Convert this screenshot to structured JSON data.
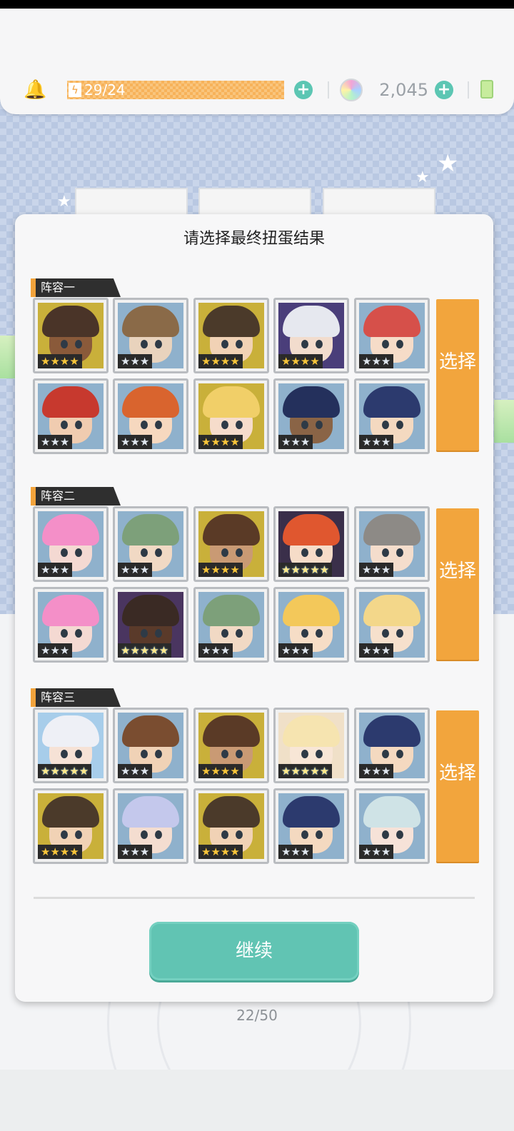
{
  "topbar": {
    "stamina": "29/24",
    "gems": "2,045"
  },
  "modal": {
    "title": "请选择最终扭蛋结果",
    "continue_label": "继续",
    "select_label": "选择"
  },
  "groups": [
    {
      "name": "阵容一",
      "characters": [
        {
          "stars": 4,
          "rank": "gold",
          "hair": "#4a3428",
          "skin": "#8a5a3a",
          "bg": "#c9b03a"
        },
        {
          "stars": 3,
          "rank": "silver",
          "hair": "#8a6a48",
          "skin": "#e9d3bd",
          "bg": "#8fb1cc"
        },
        {
          "stars": 4,
          "rank": "gold",
          "hair": "#4b3a2a",
          "skin": "#f1d2b5",
          "bg": "#c9b03a"
        },
        {
          "stars": 4,
          "rank": "gold",
          "hair": "#e6e8ef",
          "skin": "#f2dccd",
          "bg": "#4a3e7a"
        },
        {
          "stars": 3,
          "rank": "silver",
          "hair": "#d6504a",
          "skin": "#f6dcc8",
          "bg": "#8fb1cc"
        },
        {
          "stars": 3,
          "rank": "silver",
          "hair": "#c7392e",
          "skin": "#f0ccb0",
          "bg": "#8fb1cc"
        },
        {
          "stars": 3,
          "rank": "silver",
          "hair": "#d9642e",
          "skin": "#f6d8bf",
          "bg": "#8fb1cc"
        },
        {
          "stars": 4,
          "rank": "gold",
          "hair": "#f1cf68",
          "skin": "#f6dccb",
          "bg": "#c9b03a"
        },
        {
          "stars": 3,
          "rank": "silver",
          "hair": "#24305c",
          "skin": "#8a6446",
          "bg": "#8fb1cc"
        },
        {
          "stars": 3,
          "rank": "silver",
          "hair": "#2c3a6e",
          "skin": "#f4d9c0",
          "bg": "#8fb1cc"
        }
      ]
    },
    {
      "name": "阵容二",
      "characters": [
        {
          "stars": 3,
          "rank": "silver",
          "hair": "#f48fc8",
          "skin": "#f4d9d2",
          "bg": "#8fb1cc"
        },
        {
          "stars": 3,
          "rank": "silver",
          "hair": "#7da07a",
          "skin": "#f1d9c4",
          "bg": "#8fb1cc"
        },
        {
          "stars": 4,
          "rank": "gold",
          "hair": "#5a3a26",
          "skin": "#c99a74",
          "bg": "#c9b03a"
        },
        {
          "stars": 5,
          "rank": "rainbow",
          "hair": "#e0572f",
          "skin": "#f6dcc8",
          "bg": "#3a2f4a"
        },
        {
          "stars": 3,
          "rank": "silver",
          "hair": "#8d8a86",
          "skin": "#f4ddcc",
          "bg": "#8fb1cc"
        },
        {
          "stars": 3,
          "rank": "silver",
          "hair": "#f48fc8",
          "skin": "#f4d9d2",
          "bg": "#8fb1cc"
        },
        {
          "stars": 5,
          "rank": "rainbow",
          "hair": "#3a2a24",
          "skin": "#5a3a2a",
          "bg": "#4a3560"
        },
        {
          "stars": 3,
          "rank": "silver",
          "hair": "#7da07a",
          "skin": "#f1d9c4",
          "bg": "#8fb1cc"
        },
        {
          "stars": 3,
          "rank": "silver",
          "hair": "#f3c85a",
          "skin": "#f6ddc6",
          "bg": "#8fb1cc"
        },
        {
          "stars": 3,
          "rank": "silver",
          "hair": "#f3d78a",
          "skin": "#f6e0cc",
          "bg": "#8fb1cc"
        }
      ]
    },
    {
      "name": "阵容三",
      "characters": [
        {
          "stars": 5,
          "rank": "rainbow",
          "hair": "#eef0f6",
          "skin": "#f6e2d6",
          "bg": "#a7cdea"
        },
        {
          "stars": 3,
          "rank": "silver",
          "hair": "#7a4d30",
          "skin": "#f0d2b6",
          "bg": "#8fb1cc"
        },
        {
          "stars": 4,
          "rank": "gold",
          "hair": "#5a3a26",
          "skin": "#c99a74",
          "bg": "#c9b03a"
        },
        {
          "stars": 5,
          "rank": "rainbow",
          "hair": "#f6e4b0",
          "skin": "#f8e6d6",
          "bg": "#f0e0c8"
        },
        {
          "stars": 3,
          "rank": "silver",
          "hair": "#2c3a6e",
          "skin": "#f4d9c0",
          "bg": "#8fb1cc"
        },
        {
          "stars": 4,
          "rank": "gold",
          "hair": "#4b3a2a",
          "skin": "#f1d2b5",
          "bg": "#c9b03a"
        },
        {
          "stars": 3,
          "rank": "silver",
          "hair": "#c4c8ec",
          "skin": "#f4ddd0",
          "bg": "#8fb1cc"
        },
        {
          "stars": 4,
          "rank": "gold",
          "hair": "#4b3a2a",
          "skin": "#f1d2b5",
          "bg": "#c9b03a"
        },
        {
          "stars": 3,
          "rank": "silver",
          "hair": "#2c3a6e",
          "skin": "#f4d9c0",
          "bg": "#8fb1cc"
        },
        {
          "stars": 3,
          "rank": "silver",
          "hair": "#cfe3e6",
          "skin": "#f6e2d8",
          "bg": "#8fb1cc"
        }
      ]
    }
  ],
  "footer": {
    "progress": "22/50"
  },
  "colors": {
    "accent_teal": "#61c4b3",
    "select_orange": "#f2a53d",
    "stamina_orange": "#f7b25a"
  }
}
